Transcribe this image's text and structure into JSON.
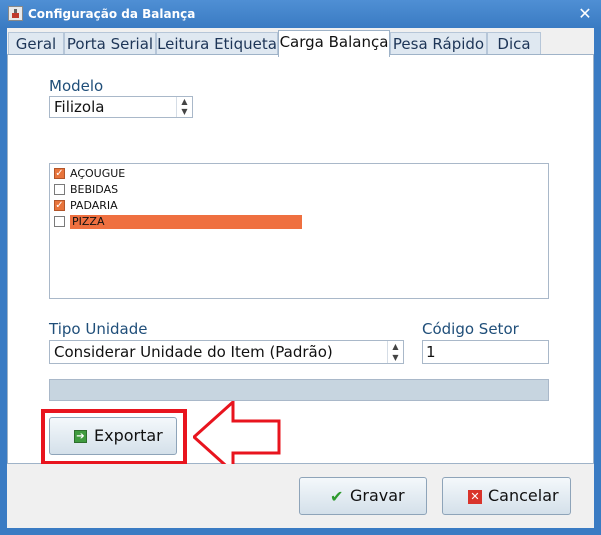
{
  "window": {
    "title": "Configuração da Balança",
    "close_glyph": "✕"
  },
  "tabs": [
    {
      "label": "Geral",
      "active": false
    },
    {
      "label": "Porta Serial",
      "active": false
    },
    {
      "label": "Leitura Etiqueta",
      "active": false
    },
    {
      "label": "Carga Balança",
      "active": true
    },
    {
      "label": "Pesa Rápido",
      "active": false
    },
    {
      "label": "Dica",
      "active": false
    }
  ],
  "modelo": {
    "label": "Modelo",
    "value": "Filizola"
  },
  "sectors": [
    {
      "label": "AÇOUGUE",
      "checked": true,
      "selected": false
    },
    {
      "label": "BEBIDAS",
      "checked": false,
      "selected": false
    },
    {
      "label": "PADARIA",
      "checked": true,
      "selected": false
    },
    {
      "label": "PIZZA",
      "checked": false,
      "selected": true
    }
  ],
  "tipo_unidade": {
    "label": "Tipo Unidade",
    "value": "Considerar Unidade do Item (Padrão)"
  },
  "codigo_setor": {
    "label": "Código Setor",
    "value": "1"
  },
  "progress": {
    "fraction": 0
  },
  "buttons": {
    "exportar": "Exportar",
    "gravar": "Gravar",
    "cancelar": "Cancelar"
  },
  "icons": {
    "app": "scale-app-icon",
    "export": "export-arrow-icon",
    "save": "check-icon",
    "cancel": "x-icon",
    "annotation": "left-arrow-annotation-icon"
  },
  "colors": {
    "titlebar": "#3a7bc3",
    "selection": "#ef7040",
    "checkbox_checked": "#e8743b",
    "annotation_red": "#e8141e"
  }
}
